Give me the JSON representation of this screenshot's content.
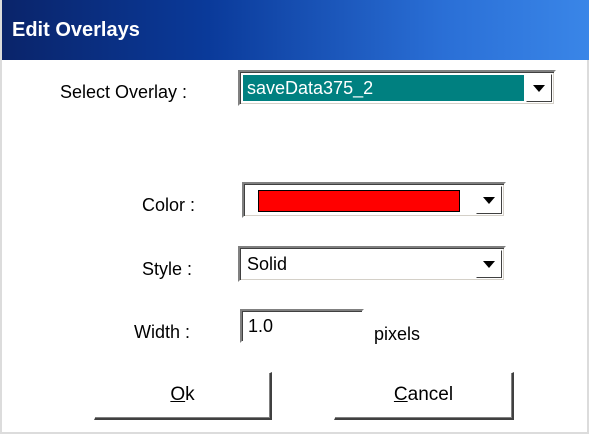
{
  "window": {
    "title": "Edit Overlays"
  },
  "overlay": {
    "label": "Select Overlay :",
    "selected": "saveData375_2"
  },
  "color": {
    "label": "Color :",
    "value": "#ff0000"
  },
  "style": {
    "label": "Style :",
    "selected": "Solid"
  },
  "width": {
    "label": "Width :",
    "value": "1.0",
    "unit": "pixels"
  },
  "buttons": {
    "ok_mnemonic": "O",
    "ok_rest": "k",
    "cancel_mnemonic": "C",
    "cancel_rest": "ancel"
  },
  "icons": {
    "dropdown": "chevron-down-icon"
  },
  "colors": {
    "title_bar_start": "#0a246a",
    "title_bar_end": "#3a86e8",
    "selection_highlight": "#008080"
  }
}
